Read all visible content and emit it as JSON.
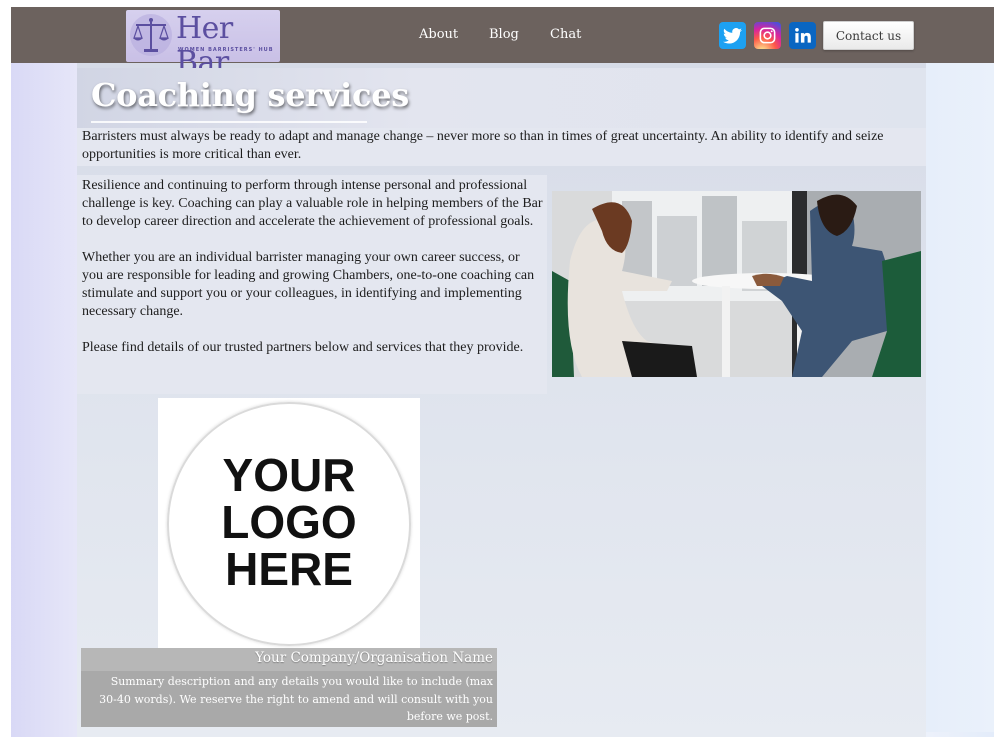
{
  "nav": {
    "brand_title": "Her Bar",
    "brand_subtitle": "WOMEN BARRISTERS' HUB",
    "links": [
      "About",
      "Blog",
      "Chat"
    ],
    "social_icons": [
      "twitter-icon",
      "instagram-icon",
      "linkedin-icon"
    ],
    "contact_label": "Contact us",
    "bar_color": "#6c625e"
  },
  "page": {
    "title": "Coaching services",
    "intro": "Barristers must always be ready to adapt and manage change – never more so than in times of great uncertainty.  An ability to identify and seize opportunities is more critical than ever.",
    "paragraphs": [
      "Resilience and continuing to perform through intense personal and professional challenge is key.  Coaching can play a valuable role in helping members of the Bar to develop career direction and accelerate the achievement of professional goals.",
      "Whether you are an individual barrister managing your own career success, or you are responsible for leading and growing Chambers, one-to-one coaching can stimulate and support you or your colleagues, in identifying and implementing necessary change.",
      "Please find details of our trusted partners below and services that they provide."
    ]
  },
  "partner": {
    "logo_text": [
      "YOUR",
      "LOGO",
      "HERE"
    ],
    "name": "Your Company/Organisation Name",
    "description": "Summary description and any details you would like to include (max 30-40 words). We reserve the right to amend and will consult with you before we post."
  }
}
